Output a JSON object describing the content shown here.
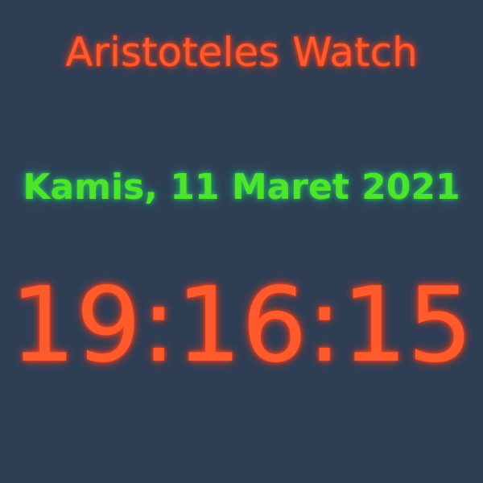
{
  "watch": {
    "title": "Aristoteles Watch",
    "date": "Kamis, 11 Maret 2021",
    "time": "19:16:15"
  },
  "colors": {
    "background": "#2e3e55",
    "title": "#ff5a2c",
    "date": "#4be62a",
    "time": "#ff5a2c"
  }
}
